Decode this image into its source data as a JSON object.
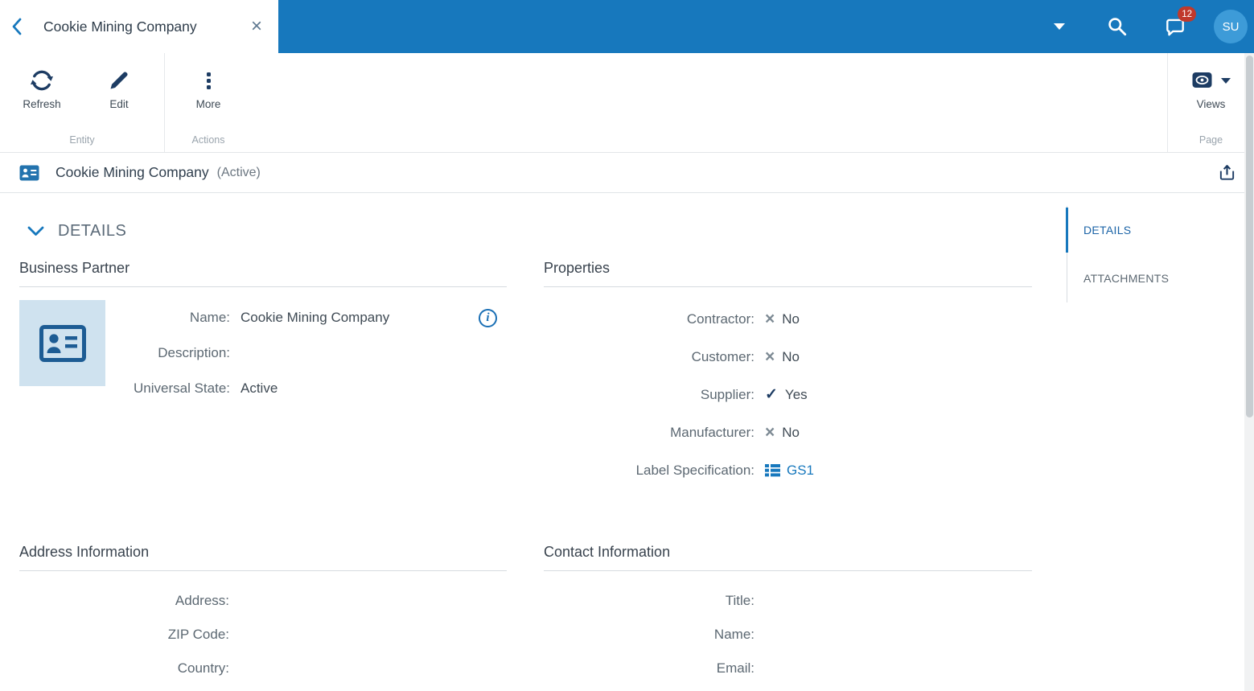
{
  "topbar": {
    "tab_title": "Cookie Mining Company",
    "notification_count": "12",
    "avatar_initials": "SU"
  },
  "ribbon": {
    "buttons": {
      "refresh": "Refresh",
      "edit": "Edit",
      "more": "More",
      "views": "Views"
    },
    "groups": {
      "entity": "Entity",
      "actions": "Actions",
      "page": "Page"
    }
  },
  "entity_header": {
    "title": "Cookie Mining Company",
    "status": "(Active)"
  },
  "main": {
    "section_title": "DETAILS",
    "business_partner": {
      "title": "Business Partner",
      "name_label": "Name:",
      "name_value": "Cookie Mining Company",
      "description_label": "Description:",
      "description_value": "",
      "universal_state_label": "Universal State:",
      "universal_state_value": "Active"
    },
    "properties": {
      "title": "Properties",
      "contractor_label": "Contractor:",
      "contractor_value": "No",
      "customer_label": "Customer:",
      "customer_value": "No",
      "supplier_label": "Supplier:",
      "supplier_value": "Yes",
      "manufacturer_label": "Manufacturer:",
      "manufacturer_value": "No",
      "label_spec_label": "Label Specification:",
      "label_spec_value": "GS1"
    },
    "address": {
      "title": "Address Information",
      "address_label": "Address:",
      "zip_label": "ZIP Code:",
      "country_label": "Country:"
    },
    "contact": {
      "title": "Contact Information",
      "title_label": "Title:",
      "name_label": "Name:",
      "email_label": "Email:"
    }
  },
  "sidebar": {
    "items": [
      {
        "label": "DETAILS"
      },
      {
        "label": "ATTACHMENTS"
      }
    ]
  },
  "icons": {
    "no_glyph": "×",
    "yes_glyph": "✓",
    "close_glyph": "×"
  },
  "colors": {
    "accent_blue": "#1778bd",
    "icon_navy": "#1d3c63",
    "badge_red": "#c0392b",
    "thumb_bg": "#cfe2ef"
  }
}
